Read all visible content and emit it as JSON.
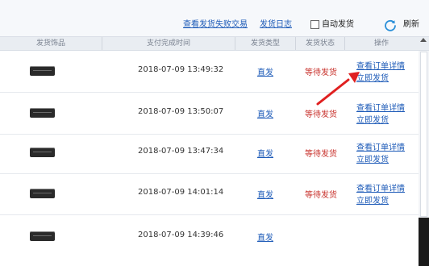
{
  "toolbar": {
    "failed_link": "查看发货失败交易",
    "log_link": "发货日志",
    "auto_label": "自动发货",
    "refresh_label": "刷新"
  },
  "columns": [
    "发货饰品",
    "支付完成时间",
    "发货类型",
    "发货状态",
    "操作"
  ],
  "rows": [
    {
      "time": "2018-07-09 13:49:32",
      "type": "直发",
      "status": "等待发货",
      "op1": "查看订单详情",
      "op2": "立即发货"
    },
    {
      "time": "2018-07-09 13:50:07",
      "type": "直发",
      "status": "等待发货",
      "op1": "查看订单详情",
      "op2": "立即发货"
    },
    {
      "time": "2018-07-09 13:47:34",
      "type": "直发",
      "status": "等待发货",
      "op1": "查看订单详情",
      "op2": "立即发货"
    },
    {
      "time": "2018-07-09 14:01:14",
      "type": "直发",
      "status": "等待发货",
      "op1": "查看订单详情",
      "op2": "立即发货"
    },
    {
      "time": "2018-07-09 14:39:46",
      "type": "直发",
      "status": "",
      "op1": "",
      "op2": ""
    }
  ],
  "colors": {
    "link": "#1e5bb8",
    "status_waiting": "#c8322c",
    "annotation_arrow": "#e02020",
    "refresh_icon": "#2a8fd8"
  },
  "icons": [
    "refresh-icon",
    "checkbox",
    "item-thumbnail",
    "annotation-arrow"
  ]
}
